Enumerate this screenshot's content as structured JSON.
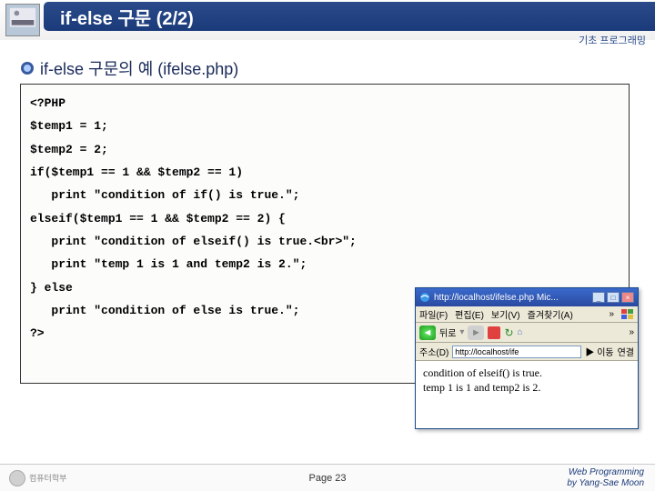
{
  "header": {
    "title": "if-else 구문 (2/2)",
    "subtitle": "기초 프로그래밍"
  },
  "section": {
    "heading": "if-else 구문의 예 (ifelse.php)"
  },
  "code": {
    "l0": "<?PHP",
    "l1": "$temp1 = 1;",
    "l2": "$temp2 = 2;",
    "l3": "",
    "l4": "if($temp1 == 1 && $temp2 == 1)",
    "l5": "   print \"condition of if() is true.\";",
    "l6": "elseif($temp1 == 1 && $temp2 == 2) {",
    "l7": "   print \"condition of elseif() is true.<br>\";",
    "l8": "   print \"temp 1 is 1 and temp2 is 2.\";",
    "l9": "} else",
    "l10": "   print \"condition of else is true.\";",
    "l11": "?>"
  },
  "browser": {
    "title": "http://localhost/ifelse.php   Mic...",
    "menu": {
      "m0": "파일(F)",
      "m1": "편집(E)",
      "m2": "보기(V)",
      "m3": "즐겨찾기(A)"
    },
    "toolbar": {
      "back_label": "뒤로"
    },
    "addr": {
      "label": "주소(D)",
      "value": "http://localhost/ife",
      "go": "이동",
      "conn": "연결"
    },
    "output": {
      "line1": "condition of elseif() is true.",
      "line2": "temp 1 is 1 and temp2 is 2."
    }
  },
  "footer": {
    "logo_text": "컴퓨터학부",
    "page": "Page 23",
    "credit1": "Web Programming",
    "credit2": "by Yang-Sae Moon"
  }
}
